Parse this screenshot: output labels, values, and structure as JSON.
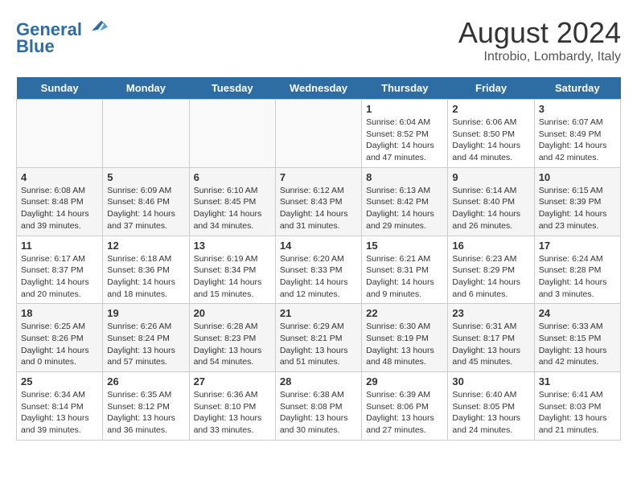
{
  "header": {
    "logo_line1": "General",
    "logo_line2": "Blue",
    "month_year": "August 2024",
    "location": "Introbio, Lombardy, Italy"
  },
  "days_of_week": [
    "Sunday",
    "Monday",
    "Tuesday",
    "Wednesday",
    "Thursday",
    "Friday",
    "Saturday"
  ],
  "weeks": [
    [
      {
        "day": "",
        "content": ""
      },
      {
        "day": "",
        "content": ""
      },
      {
        "day": "",
        "content": ""
      },
      {
        "day": "",
        "content": ""
      },
      {
        "day": "1",
        "content": "Sunrise: 6:04 AM\nSunset: 8:52 PM\nDaylight: 14 hours\nand 47 minutes."
      },
      {
        "day": "2",
        "content": "Sunrise: 6:06 AM\nSunset: 8:50 PM\nDaylight: 14 hours\nand 44 minutes."
      },
      {
        "day": "3",
        "content": "Sunrise: 6:07 AM\nSunset: 8:49 PM\nDaylight: 14 hours\nand 42 minutes."
      }
    ],
    [
      {
        "day": "4",
        "content": "Sunrise: 6:08 AM\nSunset: 8:48 PM\nDaylight: 14 hours\nand 39 minutes."
      },
      {
        "day": "5",
        "content": "Sunrise: 6:09 AM\nSunset: 8:46 PM\nDaylight: 14 hours\nand 37 minutes."
      },
      {
        "day": "6",
        "content": "Sunrise: 6:10 AM\nSunset: 8:45 PM\nDaylight: 14 hours\nand 34 minutes."
      },
      {
        "day": "7",
        "content": "Sunrise: 6:12 AM\nSunset: 8:43 PM\nDaylight: 14 hours\nand 31 minutes."
      },
      {
        "day": "8",
        "content": "Sunrise: 6:13 AM\nSunset: 8:42 PM\nDaylight: 14 hours\nand 29 minutes."
      },
      {
        "day": "9",
        "content": "Sunrise: 6:14 AM\nSunset: 8:40 PM\nDaylight: 14 hours\nand 26 minutes."
      },
      {
        "day": "10",
        "content": "Sunrise: 6:15 AM\nSunset: 8:39 PM\nDaylight: 14 hours\nand 23 minutes."
      }
    ],
    [
      {
        "day": "11",
        "content": "Sunrise: 6:17 AM\nSunset: 8:37 PM\nDaylight: 14 hours\nand 20 minutes."
      },
      {
        "day": "12",
        "content": "Sunrise: 6:18 AM\nSunset: 8:36 PM\nDaylight: 14 hours\nand 18 minutes."
      },
      {
        "day": "13",
        "content": "Sunrise: 6:19 AM\nSunset: 8:34 PM\nDaylight: 14 hours\nand 15 minutes."
      },
      {
        "day": "14",
        "content": "Sunrise: 6:20 AM\nSunset: 8:33 PM\nDaylight: 14 hours\nand 12 minutes."
      },
      {
        "day": "15",
        "content": "Sunrise: 6:21 AM\nSunset: 8:31 PM\nDaylight: 14 hours\nand 9 minutes."
      },
      {
        "day": "16",
        "content": "Sunrise: 6:23 AM\nSunset: 8:29 PM\nDaylight: 14 hours\nand 6 minutes."
      },
      {
        "day": "17",
        "content": "Sunrise: 6:24 AM\nSunset: 8:28 PM\nDaylight: 14 hours\nand 3 minutes."
      }
    ],
    [
      {
        "day": "18",
        "content": "Sunrise: 6:25 AM\nSunset: 8:26 PM\nDaylight: 14 hours\nand 0 minutes."
      },
      {
        "day": "19",
        "content": "Sunrise: 6:26 AM\nSunset: 8:24 PM\nDaylight: 13 hours\nand 57 minutes."
      },
      {
        "day": "20",
        "content": "Sunrise: 6:28 AM\nSunset: 8:23 PM\nDaylight: 13 hours\nand 54 minutes."
      },
      {
        "day": "21",
        "content": "Sunrise: 6:29 AM\nSunset: 8:21 PM\nDaylight: 13 hours\nand 51 minutes."
      },
      {
        "day": "22",
        "content": "Sunrise: 6:30 AM\nSunset: 8:19 PM\nDaylight: 13 hours\nand 48 minutes."
      },
      {
        "day": "23",
        "content": "Sunrise: 6:31 AM\nSunset: 8:17 PM\nDaylight: 13 hours\nand 45 minutes."
      },
      {
        "day": "24",
        "content": "Sunrise: 6:33 AM\nSunset: 8:15 PM\nDaylight: 13 hours\nand 42 minutes."
      }
    ],
    [
      {
        "day": "25",
        "content": "Sunrise: 6:34 AM\nSunset: 8:14 PM\nDaylight: 13 hours\nand 39 minutes."
      },
      {
        "day": "26",
        "content": "Sunrise: 6:35 AM\nSunset: 8:12 PM\nDaylight: 13 hours\nand 36 minutes."
      },
      {
        "day": "27",
        "content": "Sunrise: 6:36 AM\nSunset: 8:10 PM\nDaylight: 13 hours\nand 33 minutes."
      },
      {
        "day": "28",
        "content": "Sunrise: 6:38 AM\nSunset: 8:08 PM\nDaylight: 13 hours\nand 30 minutes."
      },
      {
        "day": "29",
        "content": "Sunrise: 6:39 AM\nSunset: 8:06 PM\nDaylight: 13 hours\nand 27 minutes."
      },
      {
        "day": "30",
        "content": "Sunrise: 6:40 AM\nSunset: 8:05 PM\nDaylight: 13 hours\nand 24 minutes."
      },
      {
        "day": "31",
        "content": "Sunrise: 6:41 AM\nSunset: 8:03 PM\nDaylight: 13 hours\nand 21 minutes."
      }
    ]
  ]
}
